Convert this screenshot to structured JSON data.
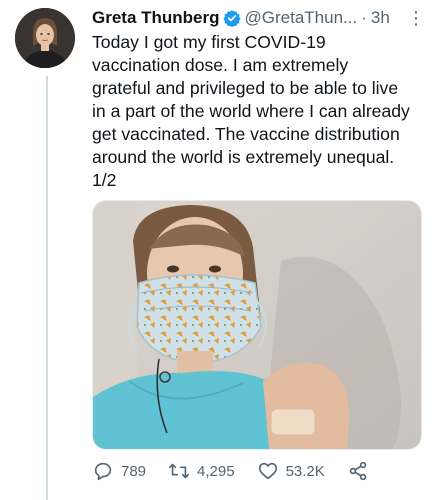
{
  "tweet": {
    "display_name": "Greta Thunberg",
    "handle": "@GretaThun...",
    "separator": "·",
    "time": "3h",
    "more_label": "⋮",
    "text": "Today I got my first COVID-19\nvaccination dose. I am extremely\ngrateful and privileged to be able to live\nin a part of the world where I can already\nget vaccinated. The vaccine distribution\naround the world is extremely unequal.\n1/2"
  },
  "actions": {
    "reply_count": "789",
    "retweet_count": "4,295",
    "like_count": "53.2K"
  },
  "icons": {
    "verified": "verified-badge-icon",
    "reply": "reply-icon",
    "retweet": "retweet-icon",
    "like": "heart-icon",
    "share": "share-icon",
    "more": "more-icon"
  },
  "colors": {
    "verified_blue": "#1d9bf0",
    "text_primary": "#0f1419",
    "text_secondary": "#536471",
    "thread_line": "#cfd9de"
  }
}
